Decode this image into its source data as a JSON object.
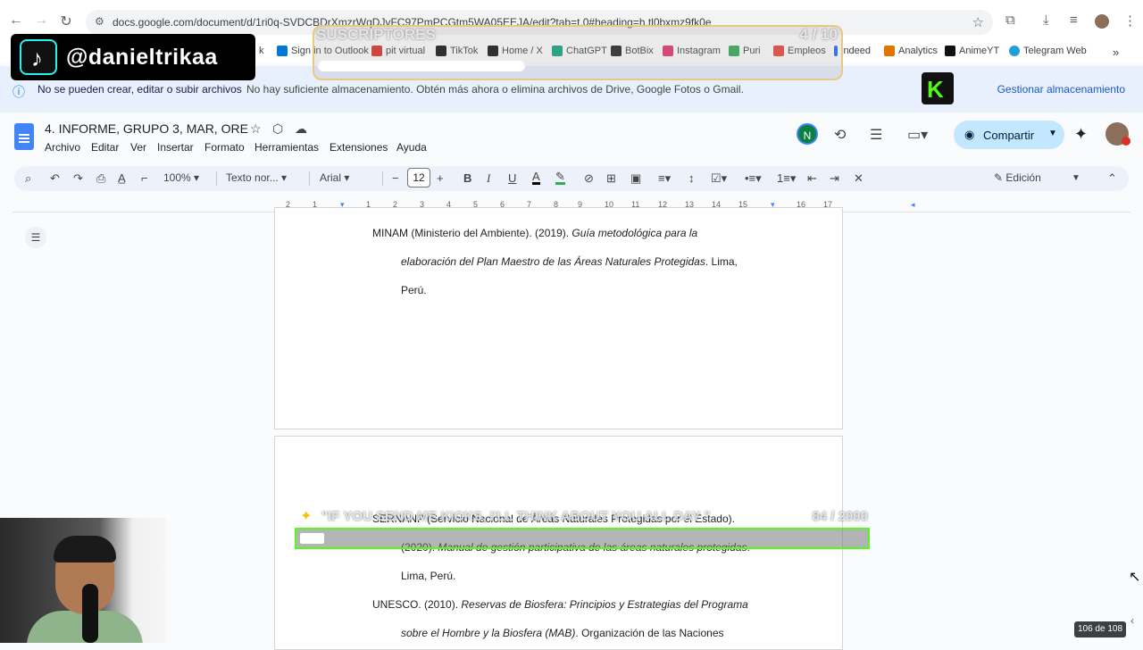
{
  "browser": {
    "url": "docs.google.com/document/d/1ri0q-SVDCBDrXmzrWqDJvFC97PmPCGtm5WA05EEJA/edit?tab=t.0#heading=h.tl0bxmz9fk0e",
    "bookmarks": [
      "Sign in to Outlook",
      "pit virtual",
      "TikTok",
      "Home / X",
      "ChatGPT",
      "BotBix",
      "Instagram",
      "Puri",
      "Empleos",
      "indeed",
      "Analytics",
      "AnimeYT",
      "Telegram Web"
    ],
    "bookmark_colors": [
      "#0078d4",
      "#d93025",
      "#111111",
      "#111111",
      "#10a37f",
      "#222222",
      "#e1306c",
      "#34a853",
      "#ea4335",
      "#2164f3",
      "#e37400",
      "#ff0000",
      "#229ed9"
    ]
  },
  "banner": {
    "title": "No se pueden crear, editar o subir archivos",
    "message": "No hay suficiente almacenamiento. Obtén más ahora o elimina archivos de Drive, Google Fotos o Gmail.",
    "action": "Gestionar almacenamiento"
  },
  "doc": {
    "title": "4. INFORME, GRUPO 3, MAR, ORE",
    "menus": [
      "Archivo",
      "Editar",
      "Ver",
      "Insertar",
      "Formato",
      "Herramientas",
      "Extensiones",
      "Ayuda"
    ],
    "user_initial": "N",
    "share_label": "Compartir"
  },
  "toolbar": {
    "zoom": "100%",
    "style": "Texto nor...",
    "font": "Arial",
    "font_size": "12",
    "mode": "Edición"
  },
  "ruler": {
    "ticks": [
      "2",
      "1",
      "1",
      "2",
      "3",
      "4",
      "5",
      "6",
      "7",
      "8",
      "9",
      "10",
      "11",
      "12",
      "13",
      "14",
      "15",
      "16",
      "17",
      "18"
    ]
  },
  "pages": {
    "ref1_line1_a": "MINAM (Ministerio del Ambiente). (2019). ",
    "ref1_line1_b": "Guía metodológica para la",
    "ref1_line2_a": "elaboración del Plan Maestro de las Áreas Naturales Protegidas",
    "ref1_line2_b": ". Lima,",
    "ref1_line3": "Perú.",
    "ref2_line1": "SERNANP (Servicio Nacional de Áreas Naturales Protegidas por el Estado).",
    "ref2_line2_a": "(2020). ",
    "ref2_line2_b": "Manual de gestión participativa de las áreas naturales protegidas",
    "ref2_line2_c": ".",
    "ref2_line3": "Lima, Perú.",
    "ref3_line1_a": "UNESCO. (2010). ",
    "ref3_line1_b": "Reservas de Biosfera: Principios y Estrategias del Programa",
    "ref3_line2_a": "sobre el Hombre y la Biosfera (MAB)",
    "ref3_line2_b": ". Organización de las Naciones",
    "page_count": "106 de 108"
  },
  "overlays": {
    "tiktok_handle": "@danieltrikaa",
    "subs_label": "SUSCRIPTORES",
    "subs_count": "4 / 10",
    "subs_progress": 0.4,
    "kick_message": "\"IF YOU SEND ME KICKS, I'LL THINK ABOUT YOU ALL DAY \"",
    "kick_count": "84 / 2000",
    "kick_progress": 0.042
  }
}
